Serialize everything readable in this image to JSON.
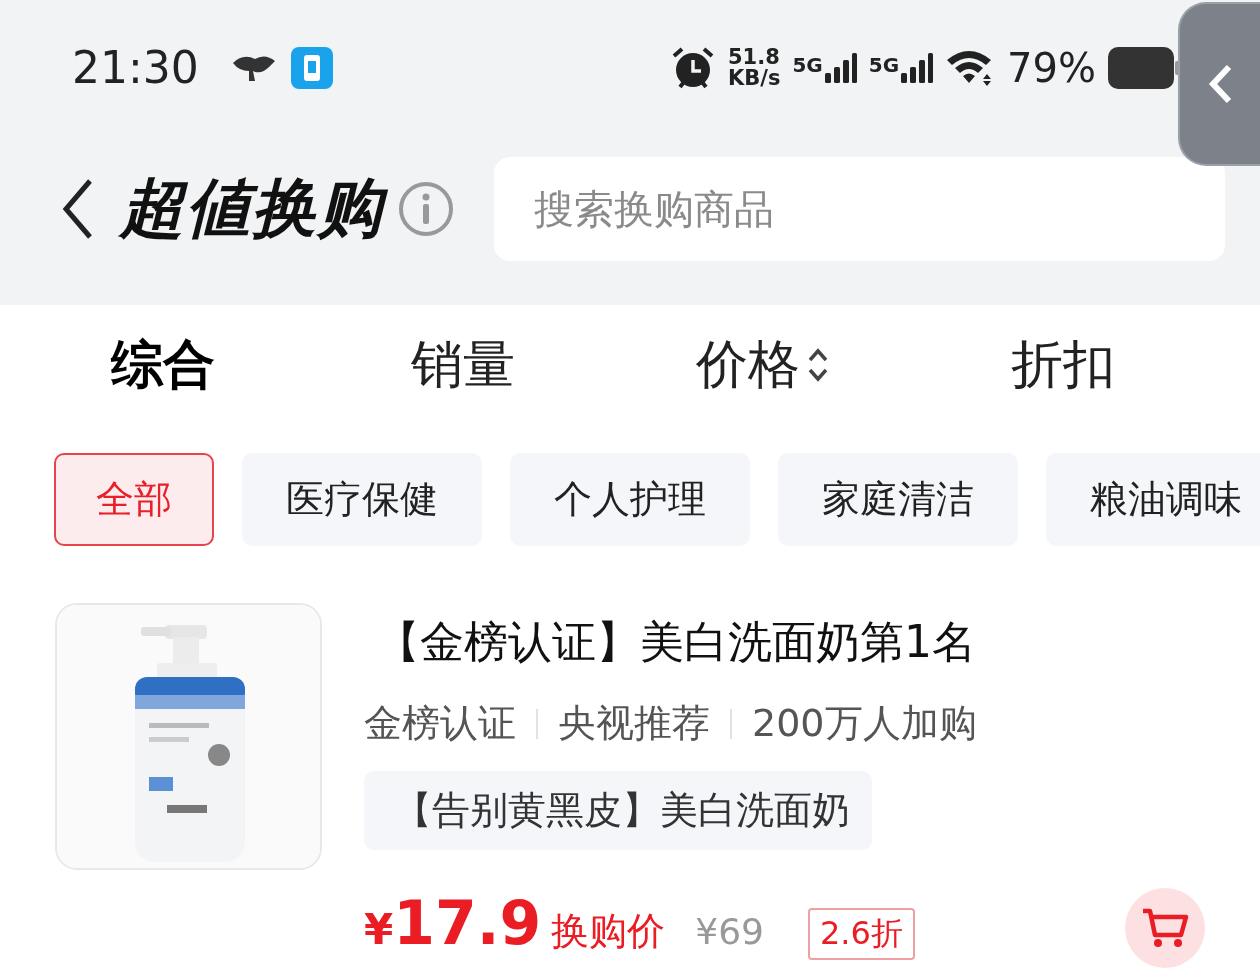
{
  "status_bar": {
    "time": "21:30",
    "net_speed": "51.8",
    "net_unit": "KB/s",
    "signals": [
      {
        "label": "5G"
      },
      {
        "label": "5G"
      }
    ],
    "battery": "79%"
  },
  "header": {
    "title": "超値换购",
    "search": {
      "placeholder": "搜索换购商品"
    }
  },
  "sort_tabs": [
    {
      "label": "综合",
      "selected": true,
      "kind": "plain"
    },
    {
      "label": "销量",
      "selected": false,
      "kind": "plain"
    },
    {
      "label": "价格",
      "selected": false,
      "kind": "sortable"
    },
    {
      "label": "折扣",
      "selected": false,
      "kind": "plain"
    }
  ],
  "categories": [
    {
      "label": "全部",
      "selected": true
    },
    {
      "label": "医疗保健",
      "selected": false
    },
    {
      "label": "个人护理",
      "selected": false
    },
    {
      "label": "家庭清洁",
      "selected": false
    },
    {
      "label": "粮油调味",
      "selected": false
    }
  ],
  "products": [
    {
      "image": {
        "kind": "picture"
      },
      "title": "【金榜认证】美白洗面奶第1名",
      "tags": [
        "金榜认证",
        "央视推荐",
        "200万人加购"
      ],
      "highlight": "【告别黄黑皮】美白洗面奶",
      "currency": "¥",
      "price": "17.9",
      "price_label": "换购价",
      "original_price": "¥69",
      "discount": "2.6折"
    }
  ]
}
